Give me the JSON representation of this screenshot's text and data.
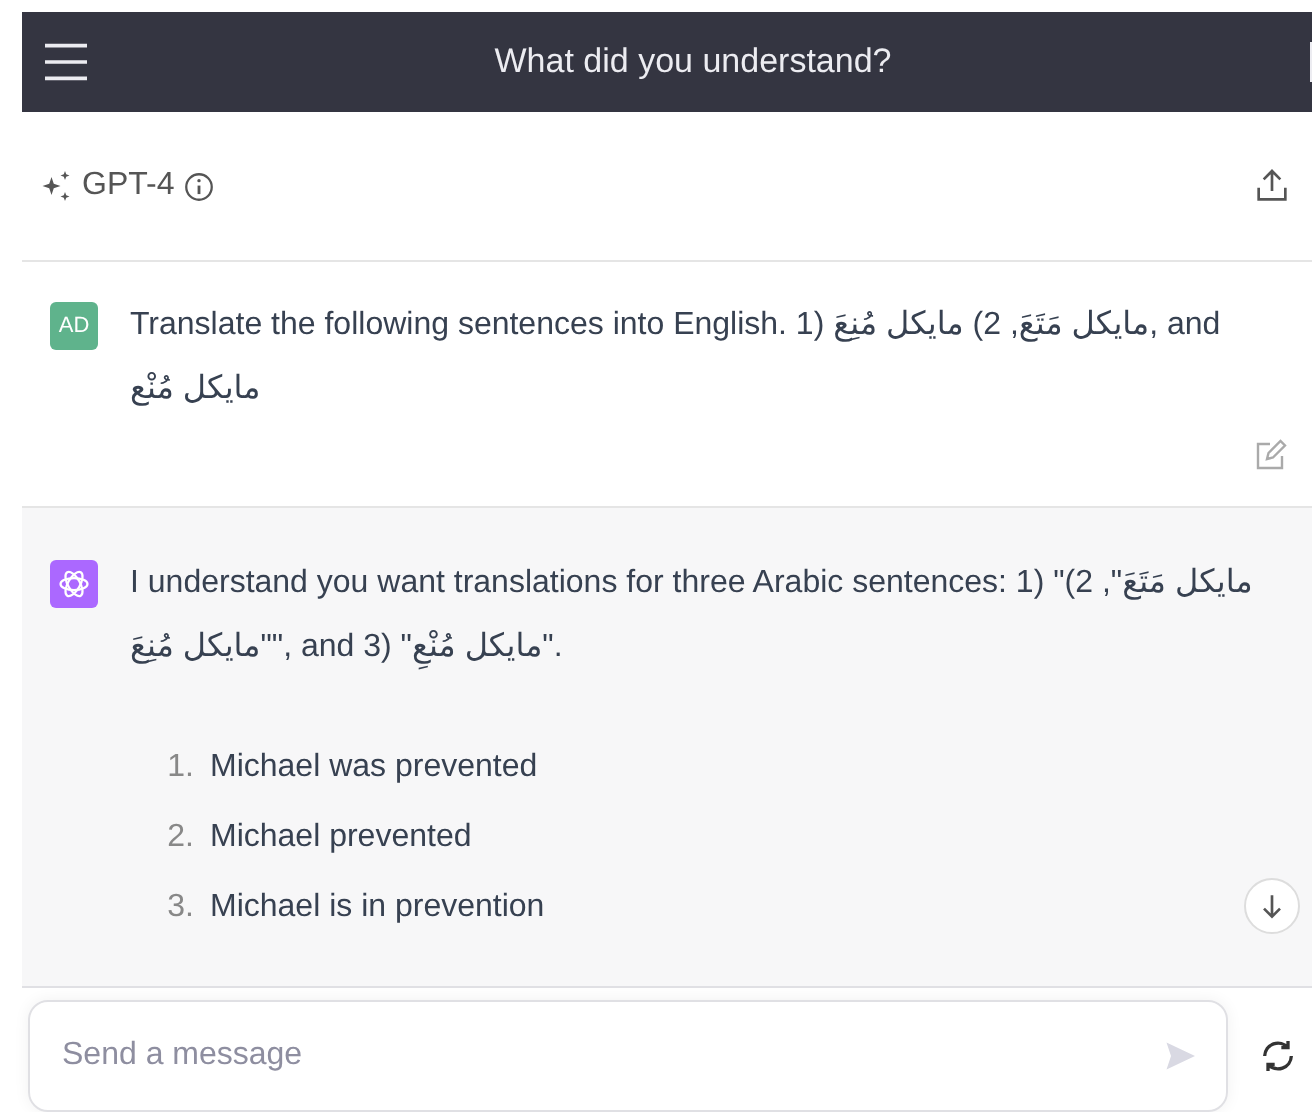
{
  "header": {
    "title": "What did you understand?"
  },
  "model": {
    "name": "GPT-4"
  },
  "messages": [
    {
      "kind": "user",
      "avatar": "AD",
      "text": "Translate the following sentences into English. 1) مايكل مَتَعَ, 2) مايكل مُنِعَ, and مايكل مُنْع"
    },
    {
      "kind": "assistant",
      "text": "I understand you want translations for three Arabic sentences: 1) \"مايكل مَتَعَ\", 2) \"مايكل مُنِعَ\", and 3) \"مايكل مُنْعِ\".",
      "list": [
        {
          "number": "1.",
          "text": "Michael was prevented"
        },
        {
          "number": "2.",
          "text": "Michael prevented"
        },
        {
          "number": "3.",
          "text": "Michael is in prevention"
        }
      ]
    }
  ],
  "composer": {
    "placeholder": "Send a message"
  }
}
